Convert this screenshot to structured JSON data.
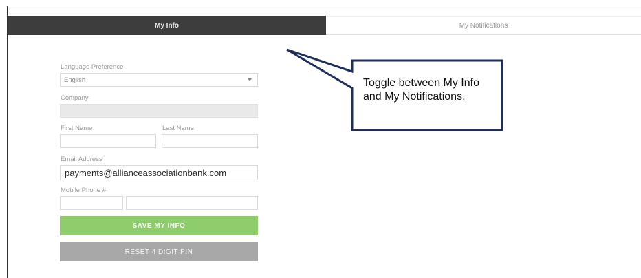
{
  "tabs": [
    {
      "label": "My Info",
      "active": true
    },
    {
      "label": "My Notifications",
      "active": false
    }
  ],
  "form": {
    "language_label": "Language Preference",
    "language_value": "English",
    "company_label": "Company",
    "company_value": "",
    "first_name_label": "First Name",
    "last_name_label": "Last Name",
    "email_label": "Email Address",
    "email_value": "payments@allianceassociationbank.com",
    "mobile_label": "Mobile Phone #"
  },
  "buttons": {
    "save_label": "SAVE MY INFO",
    "reset_label": "RESET 4 DIGIT PIN"
  },
  "callout": {
    "text": "Toggle between My Info and My Notifications."
  },
  "colors": {
    "tab_active_bg": "#3d3d3d",
    "save_button": "#8fcc6c",
    "reset_button": "#a8a8a8",
    "callout_border": "#1f2f5c"
  }
}
